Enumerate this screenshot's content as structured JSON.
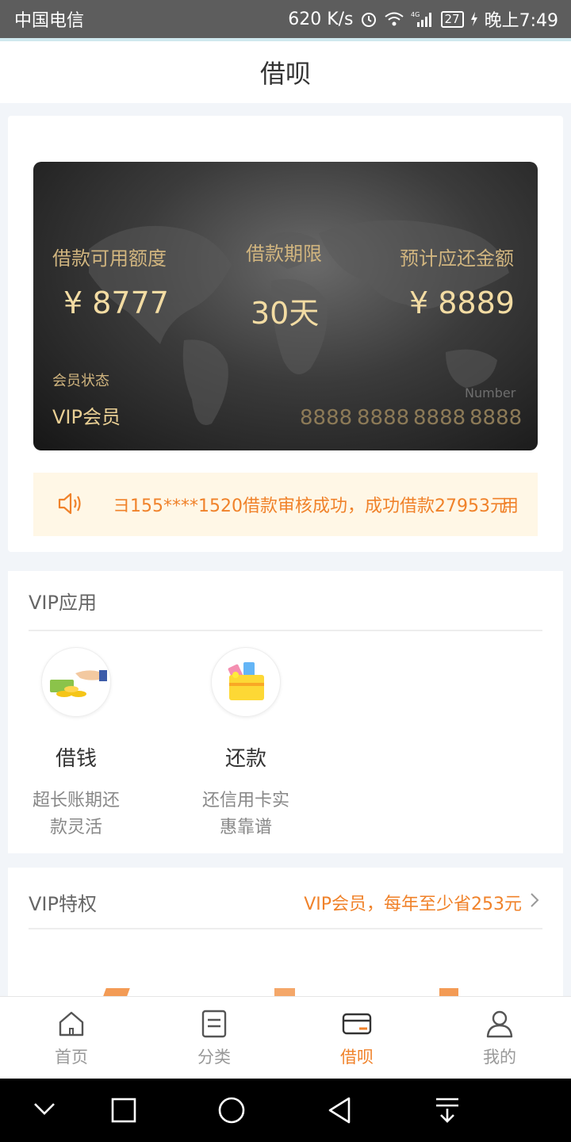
{
  "status_bar": {
    "carrier": "中国电信",
    "speed": "620 K/s",
    "battery": "27",
    "time": "晚上7:49"
  },
  "header": {
    "title": "借呗"
  },
  "card": {
    "credit_label": "借款可用额度",
    "credit_value": "¥ 8777",
    "term_label": "借款期限",
    "term_value": "30天",
    "repay_label": "预计应还金额",
    "repay_value": "¥ 8889",
    "member_label": "会员状态",
    "member_value": "VIP会员",
    "number_label": "Number",
    "digits": [
      "8888",
      "8888",
      "8888",
      "8888"
    ]
  },
  "notice": {
    "text": "ヨ155****1520借款审核成功，成功借款27953元",
    "next_fragment": "用"
  },
  "vip_apps": {
    "title": "VIP应用",
    "items": [
      {
        "name": "借钱",
        "desc_line1": "超长账期还",
        "desc_line2": "款灵活",
        "icon": "money-hand-icon"
      },
      {
        "name": "还款",
        "desc_line1": "还信用卡实",
        "desc_line2": "惠靠谱",
        "icon": "wallet-cards-icon"
      }
    ]
  },
  "vip_privilege": {
    "title": "VIP特权",
    "promo": "VIP会员，每年至少省253元"
  },
  "tabbar": {
    "tabs": [
      {
        "label": "首页",
        "icon": "home-icon",
        "active": false
      },
      {
        "label": "分类",
        "icon": "list-icon",
        "active": false
      },
      {
        "label": "借呗",
        "icon": "card-icon",
        "active": true
      },
      {
        "label": "我的",
        "icon": "user-icon",
        "active": false
      }
    ]
  },
  "colors": {
    "accent": "#f0822a",
    "gold": "#e9cf94"
  }
}
